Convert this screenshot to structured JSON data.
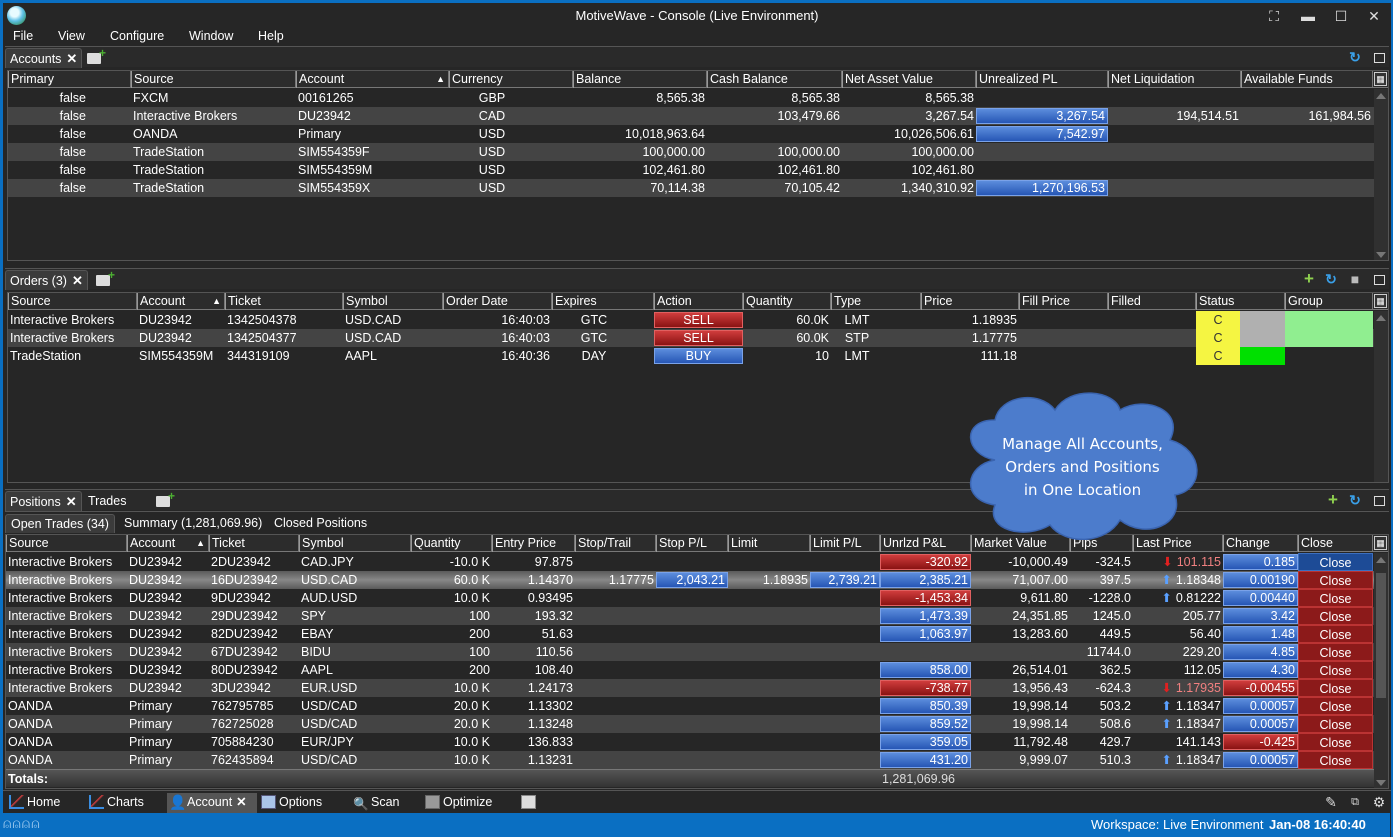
{
  "window": {
    "title": "MotiveWave - Console (Live Environment)"
  },
  "menu": [
    "File",
    "View",
    "Configure",
    "Window",
    "Help"
  ],
  "accounts_panel": {
    "tab_label": "Accounts",
    "columns": [
      "Primary",
      "Source",
      "Account",
      "Currency",
      "Balance",
      "Cash Balance",
      "Net Asset Value",
      "Unrealized PL",
      "Net Liquidation",
      "Available Funds"
    ],
    "sorted_column": "Account",
    "rows": [
      {
        "primary": "false",
        "source": "FXCM",
        "account": "00161265",
        "currency": "GBP",
        "balance": "8,565.38",
        "cash_balance": "8,565.38",
        "nav": "8,565.38",
        "unrealized": "",
        "net_liq": "",
        "avail": ""
      },
      {
        "primary": "false",
        "source": "Interactive Brokers",
        "account": "DU23942",
        "currency": "CAD",
        "balance": "",
        "cash_balance": "103,479.66",
        "nav": "3,267.54",
        "unrealized": "3,267.54",
        "net_liq": "194,514.51",
        "avail": "161,984.56"
      },
      {
        "primary": "false",
        "source": "OANDA",
        "account": "Primary",
        "currency": "USD",
        "balance": "10,018,963.64",
        "cash_balance": "",
        "nav": "10,026,506.61",
        "unrealized": "7,542.97",
        "net_liq": "",
        "avail": ""
      },
      {
        "primary": "false",
        "source": "TradeStation",
        "account": "SIM554359F",
        "currency": "USD",
        "balance": "100,000.00",
        "cash_balance": "100,000.00",
        "nav": "100,000.00",
        "unrealized": "",
        "net_liq": "",
        "avail": ""
      },
      {
        "primary": "false",
        "source": "TradeStation",
        "account": "SIM554359M",
        "currency": "USD",
        "balance": "102,461.80",
        "cash_balance": "102,461.80",
        "nav": "102,461.80",
        "unrealized": "",
        "net_liq": "",
        "avail": ""
      },
      {
        "primary": "false",
        "source": "TradeStation",
        "account": "SIM554359X",
        "currency": "USD",
        "balance": "70,114.38",
        "cash_balance": "70,105.42",
        "nav": "1,340,310.92",
        "unrealized": "1,270,196.53",
        "net_liq": "",
        "avail": ""
      }
    ]
  },
  "orders_panel": {
    "tab_label": "Orders (3)",
    "columns": [
      "Source",
      "Account",
      "Ticket",
      "Symbol",
      "Order Date",
      "Expires",
      "Action",
      "Quantity",
      "Type",
      "Price",
      "Fill Price",
      "Filled",
      "Status",
      "Group"
    ],
    "sorted_column": "Account",
    "rows": [
      {
        "source": "Interactive Brokers",
        "account": "DU23942",
        "ticket": "1342504378",
        "symbol": "USD.CAD",
        "date": "16:40:03",
        "expires": "GTC",
        "action": "SELL",
        "qty": "60.0K",
        "type": "LMT",
        "price": "1.18935",
        "fill_price": "",
        "filled": "",
        "status": "C",
        "status_color": "#f5f542",
        "status2_color": "#b0b0b0",
        "group_color": "#90ee90"
      },
      {
        "source": "Interactive Brokers",
        "account": "DU23942",
        "ticket": "1342504377",
        "symbol": "USD.CAD",
        "date": "16:40:03",
        "expires": "GTC",
        "action": "SELL",
        "qty": "60.0K",
        "type": "STP",
        "price": "1.17775",
        "fill_price": "",
        "filled": "",
        "status": "C",
        "status_color": "#f5f542",
        "status2_color": "#b0b0b0",
        "group_color": "#90ee90"
      },
      {
        "source": "TradeStation",
        "account": "SIM554359M",
        "ticket": "344319109",
        "symbol": "AAPL",
        "date": "16:40:36",
        "expires": "DAY",
        "action": "BUY",
        "qty": "10",
        "type": "LMT",
        "price": "111.18",
        "fill_price": "",
        "filled": "",
        "status": "C",
        "status_color": "#f5f542",
        "status2_color": "#00e000",
        "group_color": ""
      }
    ]
  },
  "callout": {
    "text_lines": [
      "Manage All Accounts,",
      "Orders and Positions",
      "in One Location"
    ]
  },
  "positions_panel": {
    "tabs": [
      "Positions",
      "Trades"
    ],
    "subtabs": [
      "Open Trades (34)",
      "Summary (1,281,069.96)",
      "Closed Positions"
    ],
    "columns": [
      "Source",
      "Account",
      "Ticket",
      "Symbol",
      "Quantity",
      "Entry Price",
      "Stop/Trail",
      "Stop P/L",
      "Limit",
      "Limit P/L",
      "Unrlzd P&L",
      "Market Value",
      "Pips",
      "Last Price",
      "Change",
      "Close"
    ],
    "sorted_column": "Account",
    "rows": [
      {
        "source": "Interactive Brokers",
        "account": "DU23942",
        "ticket": "2DU23942",
        "symbol": "CAD.JPY",
        "qty": "-10.0 K",
        "entry": "97.875",
        "stop": "",
        "stop_pl": "",
        "limit": "",
        "limit_pl": "",
        "upl": "-320.92",
        "upl_sign": "neg",
        "mv": "-10,000.49",
        "pips": "-324.5",
        "last": "101.115",
        "last_dir": "down",
        "change": "0.185",
        "change_sign": "pos",
        "close": "Close",
        "close_style": "blue"
      },
      {
        "source": "Interactive Brokers",
        "account": "DU23942",
        "ticket": "16DU23942",
        "symbol": "USD.CAD",
        "qty": "60.0 K",
        "entry": "1.14370",
        "stop": "1.17775",
        "stop_pl": "2,043.21",
        "limit": "1.18935",
        "limit_pl": "2,739.21",
        "upl": "2,385.21",
        "upl_sign": "pos",
        "mv": "71,007.00",
        "pips": "397.5",
        "last": "1.18348",
        "last_dir": "up",
        "change": "0.00190",
        "change_sign": "pos",
        "close": "Close",
        "close_style": "red",
        "selected": true
      },
      {
        "source": "Interactive Brokers",
        "account": "DU23942",
        "ticket": "9DU23942",
        "symbol": "AUD.USD",
        "qty": "10.0 K",
        "entry": "0.93495",
        "stop": "",
        "stop_pl": "",
        "limit": "",
        "limit_pl": "",
        "upl": "-1,453.34",
        "upl_sign": "neg",
        "mv": "9,611.80",
        "pips": "-1228.0",
        "last": "0.81222",
        "last_dir": "up",
        "change": "0.00440",
        "change_sign": "pos",
        "close": "Close",
        "close_style": "red"
      },
      {
        "source": "Interactive Brokers",
        "account": "DU23942",
        "ticket": "29DU23942",
        "symbol": "SPY",
        "qty": "100",
        "entry": "193.32",
        "stop": "",
        "stop_pl": "",
        "limit": "",
        "limit_pl": "",
        "upl": "1,473.39",
        "upl_sign": "pos",
        "mv": "24,351.85",
        "pips": "1245.0",
        "last": "205.77",
        "last_dir": "",
        "change": "3.42",
        "change_sign": "pos",
        "close": "Close",
        "close_style": "red"
      },
      {
        "source": "Interactive Brokers",
        "account": "DU23942",
        "ticket": "82DU23942",
        "symbol": "EBAY",
        "qty": "200",
        "entry": "51.63",
        "stop": "",
        "stop_pl": "",
        "limit": "",
        "limit_pl": "",
        "upl": "1,063.97",
        "upl_sign": "pos",
        "mv": "13,283.60",
        "pips": "449.5",
        "last": "56.40",
        "last_dir": "",
        "change": "1.48",
        "change_sign": "pos",
        "close": "Close",
        "close_style": "red"
      },
      {
        "source": "Interactive Brokers",
        "account": "DU23942",
        "ticket": "67DU23942",
        "symbol": "BIDU",
        "qty": "100",
        "entry": "110.56",
        "stop": "",
        "stop_pl": "",
        "limit": "",
        "limit_pl": "",
        "upl": "",
        "upl_sign": "",
        "mv": "",
        "pips": "11744.0",
        "last": "229.20",
        "last_dir": "",
        "change": "4.85",
        "change_sign": "pos",
        "close": "Close",
        "close_style": "red"
      },
      {
        "source": "Interactive Brokers",
        "account": "DU23942",
        "ticket": "80DU23942",
        "symbol": "AAPL",
        "qty": "200",
        "entry": "108.40",
        "stop": "",
        "stop_pl": "",
        "limit": "",
        "limit_pl": "",
        "upl": "858.00",
        "upl_sign": "pos",
        "mv": "26,514.01",
        "pips": "362.5",
        "last": "112.05",
        "last_dir": "",
        "change": "4.30",
        "change_sign": "pos",
        "close": "Close",
        "close_style": "red"
      },
      {
        "source": "Interactive Brokers",
        "account": "DU23942",
        "ticket": "3DU23942",
        "symbol": "EUR.USD",
        "qty": "10.0 K",
        "entry": "1.24173",
        "stop": "",
        "stop_pl": "",
        "limit": "",
        "limit_pl": "",
        "upl": "-738.77",
        "upl_sign": "neg",
        "mv": "13,956.43",
        "pips": "-624.3",
        "last": "1.17935",
        "last_dir": "down",
        "change": "-0.00455",
        "change_sign": "neg",
        "close": "Close",
        "close_style": "red"
      },
      {
        "source": "OANDA",
        "account": "Primary",
        "ticket": "762795785",
        "symbol": "USD/CAD",
        "qty": "20.0 K",
        "entry": "1.13302",
        "stop": "",
        "stop_pl": "",
        "limit": "",
        "limit_pl": "",
        "upl": "850.39",
        "upl_sign": "pos",
        "mv": "19,998.14",
        "pips": "503.2",
        "last": "1.18347",
        "last_dir": "up",
        "change": "0.00057",
        "change_sign": "pos",
        "close": "Close",
        "close_style": "red"
      },
      {
        "source": "OANDA",
        "account": "Primary",
        "ticket": "762725028",
        "symbol": "USD/CAD",
        "qty": "20.0 K",
        "entry": "1.13248",
        "stop": "",
        "stop_pl": "",
        "limit": "",
        "limit_pl": "",
        "upl": "859.52",
        "upl_sign": "pos",
        "mv": "19,998.14",
        "pips": "508.6",
        "last": "1.18347",
        "last_dir": "up",
        "change": "0.00057",
        "change_sign": "pos",
        "close": "Close",
        "close_style": "red"
      },
      {
        "source": "OANDA",
        "account": "Primary",
        "ticket": "705884230",
        "symbol": "EUR/JPY",
        "qty": "10.0 K",
        "entry": "136.833",
        "stop": "",
        "stop_pl": "",
        "limit": "",
        "limit_pl": "",
        "upl": "359.05",
        "upl_sign": "pos",
        "mv": "11,792.48",
        "pips": "429.7",
        "last": "141.143",
        "last_dir": "",
        "change": "-0.425",
        "change_sign": "neg",
        "close": "Close",
        "close_style": "red"
      },
      {
        "source": "OANDA",
        "account": "Primary",
        "ticket": "762435894",
        "symbol": "USD/CAD",
        "qty": "10.0 K",
        "entry": "1.13231",
        "stop": "",
        "stop_pl": "",
        "limit": "",
        "limit_pl": "",
        "upl": "431.20",
        "upl_sign": "pos",
        "mv": "9,999.07",
        "pips": "510.3",
        "last": "1.18347",
        "last_dir": "up",
        "change": "0.00057",
        "change_sign": "pos",
        "close": "Close",
        "close_style": "red"
      }
    ],
    "totals_label": "Totals:",
    "totals_upl": "1,281,069.96"
  },
  "bottom_tabs": [
    "Home",
    "Charts",
    "Account",
    "Options",
    "Scan",
    "Optimize"
  ],
  "active_bottom_tab": "Account",
  "status": {
    "workspace": "Workspace: Live Environment",
    "datetime": "Jan-08 16:40:40"
  },
  "colors": {
    "accent": "#0a6fc2",
    "positive": "#2656b5",
    "negative": "#8a1212"
  }
}
